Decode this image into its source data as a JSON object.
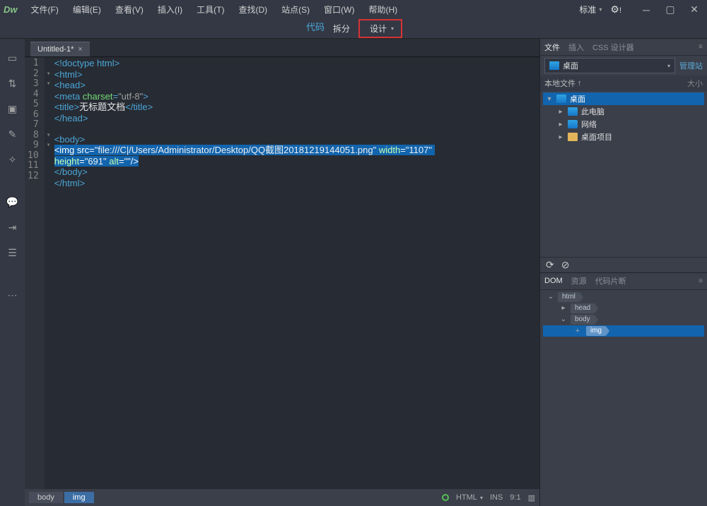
{
  "logo": "Dw",
  "menu": [
    "文件(F)",
    "编辑(E)",
    "查看(V)",
    "插入(I)",
    "工具(T)",
    "查找(D)",
    "站点(S)",
    "窗口(W)",
    "帮助(H)"
  ],
  "workspace": "标准",
  "viewTabs": {
    "code": "代码",
    "split": "拆分",
    "design": "设计"
  },
  "fileTab": "Untitled-1*",
  "lines": [
    "1",
    "2",
    "3",
    "4",
    "5",
    "6",
    "7",
    "8",
    "9",
    "10",
    "11",
    "12"
  ],
  "fold": [
    " ",
    "▾",
    "▾",
    " ",
    " ",
    " ",
    " ",
    "▾",
    "▾",
    " ",
    " ",
    " "
  ],
  "code": {
    "l1": "<!doctype html>",
    "l2o": "<",
    "l2t": "html",
    "l2c": ">",
    "l3o": "<",
    "l3t": "head",
    "l3c": ">",
    "l4o": "<",
    "l4t": "meta",
    "l4a": " charset",
    "l4e": "=",
    "l4q": "\"utf-8\"",
    "l4c": ">",
    "l5o": "<",
    "l5t": "title",
    "l5c1": ">",
    "l5x": "无标题文档",
    "l5o2": "</",
    "l5t2": "title",
    "l5c2": ">",
    "l6o": "</",
    "l6t": "head",
    "l6c": ">",
    "l8o": "<",
    "l8t": "body",
    "l8c": ">",
    "l9a": "<img src=",
    "l9s": "\"file:///C|/Users/Administrator/Desktop/QQ截图20181219144051.png\"",
    "l9w": " width",
    "l9e1": "=",
    "l9wv": "\"1107\" ",
    "l9b": "height",
    "l9e2": "=",
    "l9hv": "\"691\"",
    "l9al": " alt",
    "l9e3": "=",
    "l9av": "\"\"",
    "l9c": "/>",
    "l10o": "</",
    "l10t": "body",
    "l10c": ">",
    "l11o": "</",
    "l11t": "html",
    "l11c": ">"
  },
  "breadcrumb": [
    "body",
    "img"
  ],
  "status": {
    "lang": "HTML",
    "ins": "INS",
    "pos": "9:1"
  },
  "filesPanel": {
    "tabs": [
      "文件",
      "插入",
      "CSS 设计器"
    ],
    "activeTab": 0,
    "dropdown": "桌面",
    "manage": "管理站",
    "sub": {
      "local": "本地文件",
      "up": "↑",
      "size": "大小"
    },
    "tree": [
      {
        "label": "桌面",
        "icon": "desktop",
        "indent": 0,
        "selected": true,
        "arrow": "▾"
      },
      {
        "label": "此电脑",
        "icon": "pc",
        "indent": 1,
        "arrow": "▸"
      },
      {
        "label": "网络",
        "icon": "net",
        "indent": 1,
        "arrow": "▸"
      },
      {
        "label": "桌面项目",
        "icon": "folder",
        "indent": 1,
        "arrow": "▸"
      }
    ]
  },
  "domPanel": {
    "tabs": [
      "DOM",
      "资源",
      "代码片断"
    ],
    "activeTab": 0,
    "nodes": [
      {
        "tag": "html",
        "indent": 0,
        "arrow": "⌄"
      },
      {
        "tag": "head",
        "indent": 1,
        "arrow": "▸"
      },
      {
        "tag": "body",
        "indent": 1,
        "arrow": "⌄"
      },
      {
        "tag": "img",
        "indent": 2,
        "selected": true,
        "plus": true
      }
    ]
  }
}
